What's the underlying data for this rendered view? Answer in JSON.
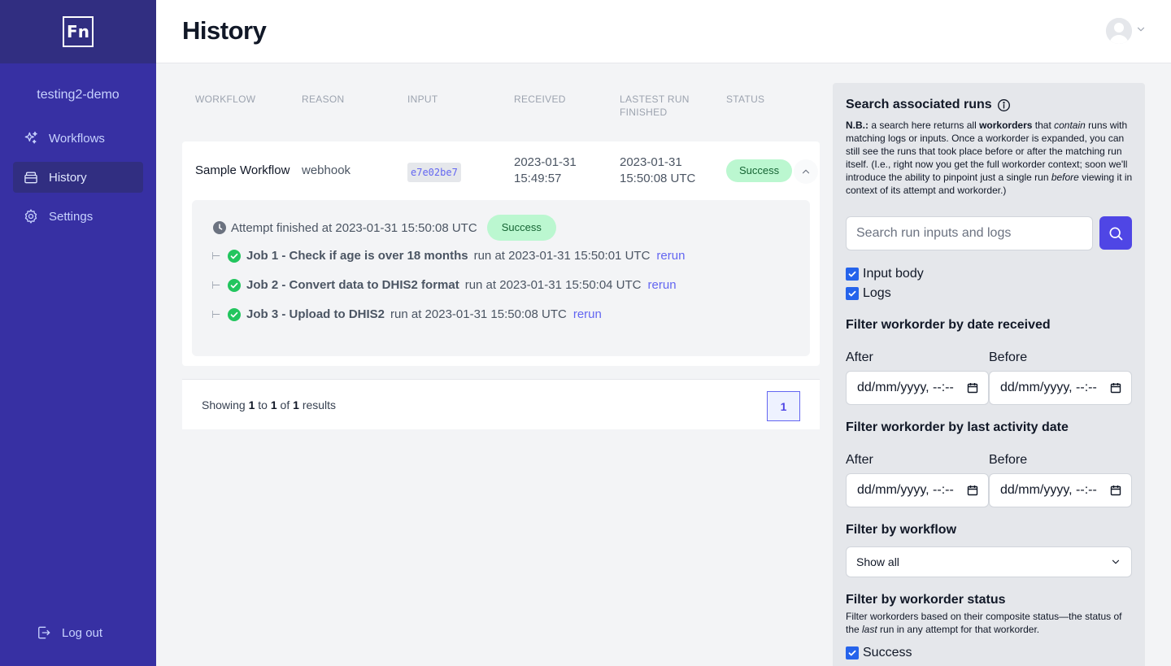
{
  "sidebar": {
    "logo": "Fn",
    "project": "testing2-demo",
    "items": [
      {
        "label": "Workflows",
        "icon": "sparkles-icon"
      },
      {
        "label": "History",
        "icon": "archive-box-icon"
      },
      {
        "label": "Settings",
        "icon": "gear-icon"
      }
    ],
    "logout": "Log out"
  },
  "header": {
    "title": "History"
  },
  "table": {
    "columns": [
      "WORKFLOW",
      "REASON",
      "INPUT",
      "RECEIVED",
      "LASTEST RUN FINISHED",
      "STATUS"
    ],
    "rows": [
      {
        "workflow": "Sample Workflow",
        "reason": "webhook",
        "input": "e7e02be7",
        "received_date": "2023-01-31",
        "received_time": "15:49:57",
        "finished_date": "2023-01-31",
        "finished_time": "15:50:08 UTC",
        "status": "Success",
        "attempt": {
          "text": "Attempt finished at 2023-01-31 15:50:08 UTC",
          "status": "Success",
          "runs": [
            {
              "job": "Job 1 - Check if age is over 18 months",
              "when": "run at 2023-01-31 15:50:01 UTC",
              "action": "rerun"
            },
            {
              "job": "Job 2 - Convert data to DHIS2 format",
              "when": "run at 2023-01-31 15:50:04 UTC",
              "action": "rerun"
            },
            {
              "job": "Job 3 - Upload to DHIS2",
              "when": "run at 2023-01-31 15:50:08 UTC",
              "action": "rerun"
            }
          ]
        }
      }
    ]
  },
  "pagination": {
    "showing": "Showing",
    "from": "1",
    "to_word": "to",
    "to": "1",
    "of_word": "of",
    "total": "1",
    "results": "results",
    "current_page": "1"
  },
  "panel": {
    "title": "Search associated runs",
    "note_parts": {
      "nb": "N.B.:",
      "p1": " a search here returns all ",
      "workorders": "workorders",
      "p2": " that ",
      "contain": "contain",
      "p3": " runs with matching logs or inputs. Once a workorder is expanded, you can still see the runs that took place before or after the matching run itself. (I.e., right now you get the full workorder context; soon we'll introduce the ability to pinpoint just a single run ",
      "before": "before",
      "p4": " viewing it in context of its attempt and workorder.)"
    },
    "search_placeholder": "Search run inputs and logs",
    "checkboxes": [
      {
        "label": "Input body",
        "checked": true
      },
      {
        "label": "Logs",
        "checked": true
      }
    ],
    "date_received": {
      "heading": "Filter workorder by date received",
      "after": "After",
      "before": "Before",
      "after_value": "dd/mm/yyyy, --:--",
      "before_value": "dd/mm/yyyy, --:--"
    },
    "last_activity": {
      "heading": "Filter workorder by last activity date",
      "after": "After",
      "before": "Before",
      "after_value": "dd/mm/yyyy, --:--",
      "before_value": "dd/mm/yyyy, --:--"
    },
    "workflow_filter": {
      "heading": "Filter by workflow",
      "selected": "Show all"
    },
    "status_filter": {
      "heading": "Filter by workorder status",
      "note_p1": "Filter workorders based on their composite status—the status of the ",
      "note_last": "last",
      "note_p2": " run in any attempt for that workorder.",
      "first_option": "Success"
    }
  },
  "colors": {
    "sidebar": "#3730a3",
    "sidebar_dark": "#312e81",
    "accent": "#4f46e5",
    "success_bg": "#bbf7d0",
    "success_text": "#166534"
  }
}
